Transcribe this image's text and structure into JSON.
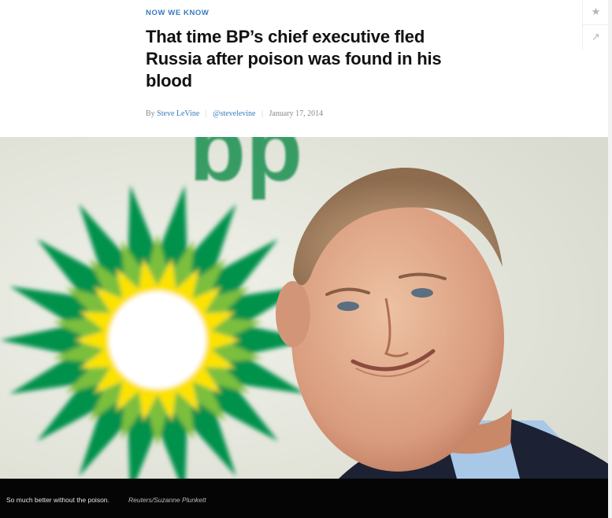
{
  "article": {
    "kicker": "NOW WE KNOW",
    "headline": "That time BP’s chief executive fled Russia after poison was found in his blood",
    "byline": {
      "prefix": "By",
      "author": "Steve LeVine",
      "twitter": "@stevelevine",
      "date": "January 17, 2014"
    }
  },
  "toolbar": {
    "items": [
      {
        "icon": "star-icon",
        "glyph": "★"
      },
      {
        "icon": "share-icon",
        "glyph": "↗"
      }
    ]
  },
  "photo": {
    "logo_text": "bp",
    "caption": "So much better without the poison.",
    "credit": "Reuters/Suzanne Plunkett"
  },
  "colors": {
    "kicker": "#3a7bbd",
    "link": "#3a7bbd",
    "caption_bg": "#050505",
    "bp_green": "#00914c",
    "bp_yellow": "#fde200"
  }
}
